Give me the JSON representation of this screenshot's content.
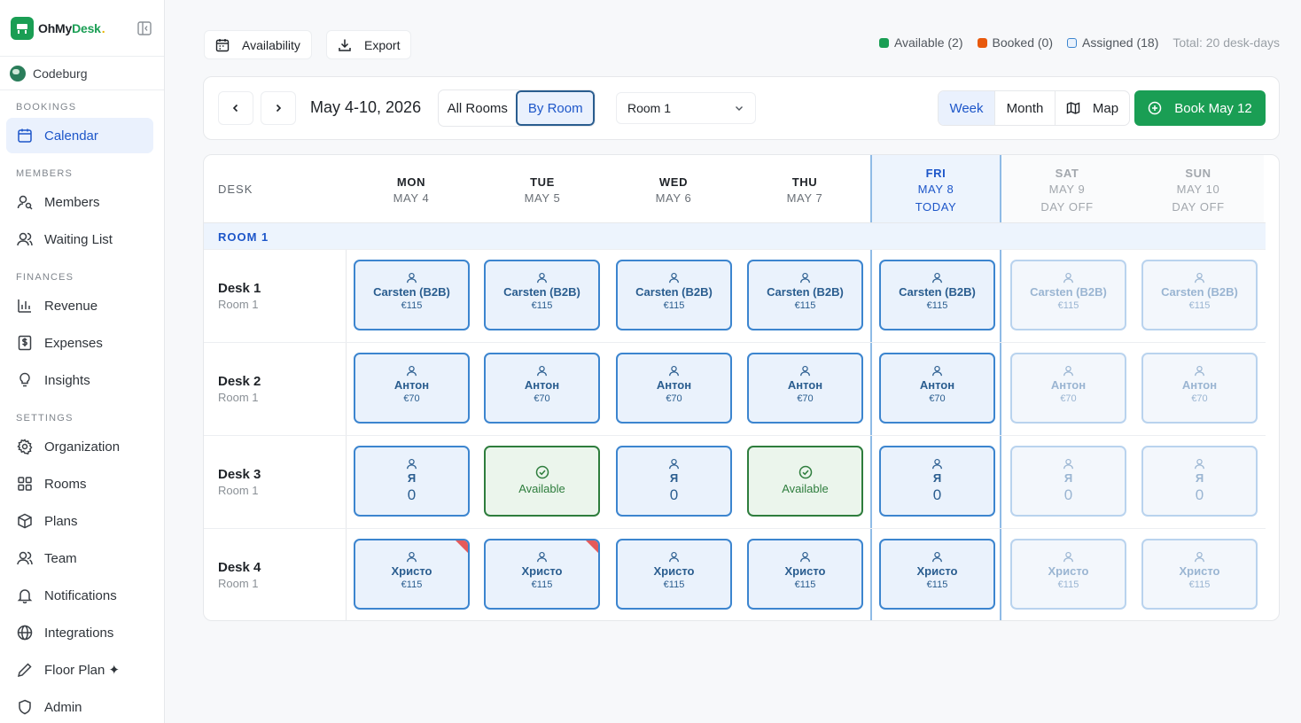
{
  "brand": {
    "name_a": "OhMy",
    "name_b": "Desk",
    "dot": "."
  },
  "org": {
    "name": "Codeburg"
  },
  "sidebar": {
    "sections": [
      {
        "label": "BOOKINGS"
      },
      {
        "label": "MEMBERS"
      },
      {
        "label": "FINANCES"
      },
      {
        "label": "SETTINGS"
      }
    ],
    "items": [
      {
        "label": "Calendar",
        "icon": "calendar-icon",
        "active": true
      },
      {
        "label": "Members",
        "icon": "user-search-icon"
      },
      {
        "label": "Waiting List",
        "icon": "users-icon"
      },
      {
        "label": "Revenue",
        "icon": "bar-chart-icon"
      },
      {
        "label": "Expenses",
        "icon": "dollar-receipt-icon"
      },
      {
        "label": "Insights",
        "icon": "lightbulb-icon"
      },
      {
        "label": "Organization",
        "icon": "gear-icon"
      },
      {
        "label": "Rooms",
        "icon": "grid-icon"
      },
      {
        "label": "Plans",
        "icon": "box-icon"
      },
      {
        "label": "Team",
        "icon": "team-icon"
      },
      {
        "label": "Notifications",
        "icon": "bell-icon"
      },
      {
        "label": "Integrations",
        "icon": "globe-icon"
      },
      {
        "label": "Floor Plan ✦",
        "icon": "pencil-icon"
      },
      {
        "label": "Admin",
        "icon": "shield-icon"
      }
    ]
  },
  "topbar": {
    "availability_label": "Availability",
    "export_label": "Export",
    "legend": [
      {
        "label": "Available (2)",
        "color": "#1a9e54"
      },
      {
        "label": "Booked (0)",
        "color": "#e8590c"
      },
      {
        "label": "Assigned (18)",
        "color": "#3c85cf"
      }
    ],
    "total": "Total: 20 desk-days"
  },
  "toolbar": {
    "date_range": "May 4-10, 2026",
    "all_rooms": "All Rooms",
    "by_room": "By Room",
    "room_select": "Room 1",
    "week": "Week",
    "month": "Month",
    "map": "Map",
    "book": "Book May 12"
  },
  "grid": {
    "desk_header": "DESK",
    "room_band": "ROOM 1",
    "days": [
      {
        "name": "MON",
        "date": "MAY 4",
        "tag": ""
      },
      {
        "name": "TUE",
        "date": "MAY 5",
        "tag": ""
      },
      {
        "name": "WED",
        "date": "MAY 6",
        "tag": ""
      },
      {
        "name": "THU",
        "date": "MAY 7",
        "tag": ""
      },
      {
        "name": "FRI",
        "date": "MAY 8",
        "tag": "TODAY"
      },
      {
        "name": "SAT",
        "date": "MAY 9",
        "tag": "DAY OFF"
      },
      {
        "name": "SUN",
        "date": "MAY 10",
        "tag": "DAY OFF"
      }
    ],
    "desks": [
      {
        "name": "Desk 1",
        "room": "Room 1",
        "cells": [
          {
            "type": "assigned",
            "name": "Carsten (B2B)",
            "price": "€115"
          },
          {
            "type": "assigned",
            "name": "Carsten (B2B)",
            "price": "€115"
          },
          {
            "type": "assigned",
            "name": "Carsten (B2B)",
            "price": "€115"
          },
          {
            "type": "assigned",
            "name": "Carsten (B2B)",
            "price": "€115"
          },
          {
            "type": "assigned",
            "name": "Carsten (B2B)",
            "price": "€115"
          },
          {
            "type": "off",
            "name": "Carsten (B2B)",
            "price": "€115"
          },
          {
            "type": "off",
            "name": "Carsten (B2B)",
            "price": "€115"
          }
        ]
      },
      {
        "name": "Desk 2",
        "room": "Room 1",
        "cells": [
          {
            "type": "assigned",
            "name": "Антон",
            "price": "€70"
          },
          {
            "type": "assigned",
            "name": "Антон",
            "price": "€70"
          },
          {
            "type": "assigned",
            "name": "Антон",
            "price": "€70"
          },
          {
            "type": "assigned",
            "name": "Антон",
            "price": "€70"
          },
          {
            "type": "assigned",
            "name": "Антон",
            "price": "€70"
          },
          {
            "type": "off",
            "name": "Антон",
            "price": "€70"
          },
          {
            "type": "off",
            "name": "Антон",
            "price": "€70"
          }
        ]
      },
      {
        "name": "Desk 3",
        "room": "Room 1",
        "cells": [
          {
            "type": "assigned",
            "name": "Я",
            "big": "0"
          },
          {
            "type": "available",
            "label": "Available"
          },
          {
            "type": "assigned",
            "name": "Я",
            "big": "0"
          },
          {
            "type": "available",
            "label": "Available"
          },
          {
            "type": "assigned",
            "name": "Я",
            "big": "0"
          },
          {
            "type": "off",
            "name": "Я",
            "big": "0"
          },
          {
            "type": "off",
            "name": "Я",
            "big": "0"
          }
        ]
      },
      {
        "name": "Desk 4",
        "room": "Room 1",
        "cells": [
          {
            "type": "assigned",
            "name": "Христо",
            "price": "€115",
            "flag": true
          },
          {
            "type": "assigned",
            "name": "Христо",
            "price": "€115",
            "flag": true
          },
          {
            "type": "assigned",
            "name": "Христо",
            "price": "€115"
          },
          {
            "type": "assigned",
            "name": "Христо",
            "price": "€115"
          },
          {
            "type": "assigned",
            "name": "Христо",
            "price": "€115"
          },
          {
            "type": "off",
            "name": "Христо",
            "price": "€115"
          },
          {
            "type": "off",
            "name": "Христо",
            "price": "€115"
          }
        ]
      }
    ]
  }
}
